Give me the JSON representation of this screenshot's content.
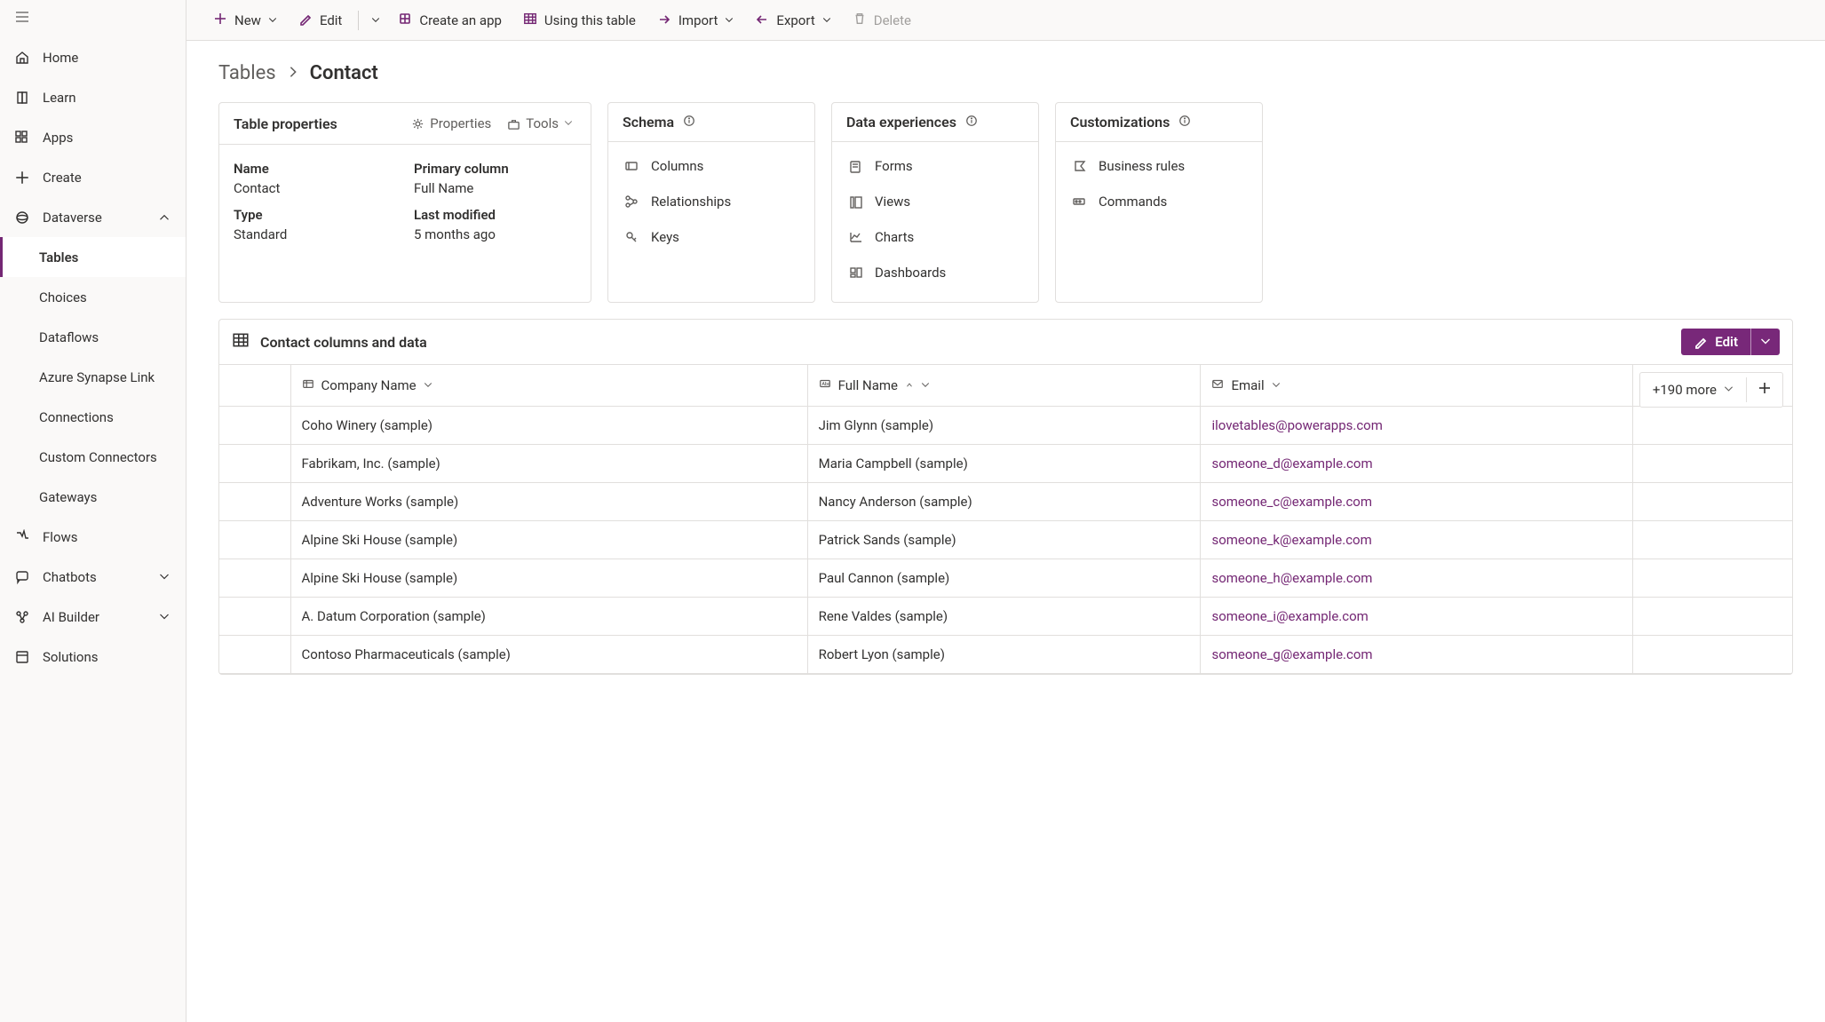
{
  "sidebar": {
    "items": [
      {
        "label": "Home",
        "icon": "home-icon"
      },
      {
        "label": "Learn",
        "icon": "book-icon"
      },
      {
        "label": "Apps",
        "icon": "apps-icon"
      },
      {
        "label": "Create",
        "icon": "plus-icon"
      },
      {
        "label": "Dataverse",
        "icon": "dataverse-icon",
        "expanded": true,
        "subs": [
          {
            "label": "Tables",
            "active": true
          },
          {
            "label": "Choices"
          },
          {
            "label": "Dataflows"
          },
          {
            "label": "Azure Synapse Link"
          },
          {
            "label": "Connections"
          },
          {
            "label": "Custom Connectors"
          },
          {
            "label": "Gateways"
          }
        ]
      },
      {
        "label": "Flows",
        "icon": "flow-icon"
      },
      {
        "label": "Chatbots",
        "icon": "chatbot-icon",
        "expandable": true
      },
      {
        "label": "AI Builder",
        "icon": "ai-icon",
        "expandable": true
      },
      {
        "label": "Solutions",
        "icon": "solutions-icon"
      }
    ]
  },
  "toolbar": {
    "new": "New",
    "edit": "Edit",
    "createApp": "Create an app",
    "usingTable": "Using this table",
    "import": "Import",
    "export": "Export",
    "delete": "Delete"
  },
  "breadcrumb": {
    "root": "Tables",
    "current": "Contact"
  },
  "properties": {
    "card_title": "Table properties",
    "properties_label": "Properties",
    "tools_label": "Tools",
    "name_label": "Name",
    "name_value": "Contact",
    "primary_label": "Primary column",
    "primary_value": "Full Name",
    "type_label": "Type",
    "type_value": "Standard",
    "modified_label": "Last modified",
    "modified_value": "5 months ago"
  },
  "schema": {
    "title": "Schema",
    "columns": "Columns",
    "relationships": "Relationships",
    "keys": "Keys"
  },
  "experiences": {
    "title": "Data experiences",
    "forms": "Forms",
    "views": "Views",
    "charts": "Charts",
    "dashboards": "Dashboards"
  },
  "custom": {
    "title": "Customizations",
    "rules": "Business rules",
    "commands": "Commands"
  },
  "dataBlock": {
    "title": "Contact columns and data",
    "edit": "Edit",
    "more": "+190 more",
    "columns": [
      {
        "label": "Company Name",
        "type": "lookup",
        "sorted": false
      },
      {
        "label": "Full Name",
        "type": "text",
        "sorted": "asc"
      },
      {
        "label": "Email",
        "type": "email",
        "sorted": false
      }
    ],
    "rows": [
      {
        "company": "Coho Winery (sample)",
        "name": "Jim Glynn (sample)",
        "email": "ilovetables@powerapps.com"
      },
      {
        "company": "Fabrikam, Inc. (sample)",
        "name": "Maria Campbell (sample)",
        "email": "someone_d@example.com"
      },
      {
        "company": "Adventure Works (sample)",
        "name": "Nancy Anderson (sample)",
        "email": "someone_c@example.com"
      },
      {
        "company": "Alpine Ski House (sample)",
        "name": "Patrick Sands (sample)",
        "email": "someone_k@example.com"
      },
      {
        "company": "Alpine Ski House (sample)",
        "name": "Paul Cannon (sample)",
        "email": "someone_h@example.com"
      },
      {
        "company": "A. Datum Corporation (sample)",
        "name": "Rene Valdes (sample)",
        "email": "someone_i@example.com"
      },
      {
        "company": "Contoso Pharmaceuticals (sample)",
        "name": "Robert Lyon (sample)",
        "email": "someone_g@example.com"
      }
    ]
  }
}
